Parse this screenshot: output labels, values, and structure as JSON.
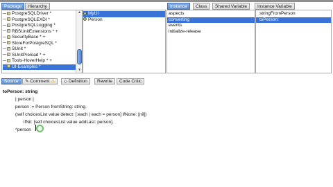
{
  "browser": {
    "packages_tabs": [
      {
        "label": "Package",
        "active": true
      },
      {
        "label": "Hierarchy",
        "active": false
      }
    ],
    "packages": [
      {
        "label": "PostgreSQLDriver *"
      },
      {
        "label": "PostgreSQLEXDI *"
      },
      {
        "label": "PostgreSQLLogging *"
      },
      {
        "label": "RBSUnitExtensions * +"
      },
      {
        "label": "SecurityBase * +"
      },
      {
        "label": "StoreForPostgreSQL *"
      },
      {
        "label": "SUnit *"
      },
      {
        "label": "SUnitPreload * +"
      },
      {
        "label": "Tools-HoverHelp * +"
      },
      {
        "label": "UI-Examples *",
        "selected": true
      }
    ],
    "classes": [
      {
        "label": "MyUI",
        "selected": true
      },
      {
        "label": "Person",
        "selected": false
      }
    ],
    "side_tabs": [
      {
        "label": "Instance",
        "active": true
      },
      {
        "label": "Class",
        "active": false
      },
      {
        "label": "Shared Variable",
        "active": false
      },
      {
        "label": "Instance Variable",
        "active": false
      }
    ],
    "protocols": [
      {
        "label": "aspects",
        "selected": false
      },
      {
        "label": "converting",
        "selected": true
      },
      {
        "label": "events",
        "selected": false
      },
      {
        "label": "initialize-release",
        "selected": false
      }
    ],
    "methods": [
      {
        "label": "stringFromPerson",
        "selected": false
      },
      {
        "label": "toPerson:",
        "selected": true
      }
    ]
  },
  "code_tabs": [
    {
      "label": "Source",
      "active": true
    },
    {
      "label": "Comment",
      "active": false
    },
    {
      "label": "Definition",
      "active": false
    },
    {
      "label": "Rewrite",
      "active": false
    },
    {
      "label": "Code Critic",
      "active": false
    }
  ],
  "code_lines": [
    "toPerson: string",
    "| person |",
    "person := Person fromString: string.",
    "(self choicesList value detect: [:each | each = person] ifNone: [nil])",
    "ifNil: [self choicesList value addLast: person].",
    "^person"
  ]
}
